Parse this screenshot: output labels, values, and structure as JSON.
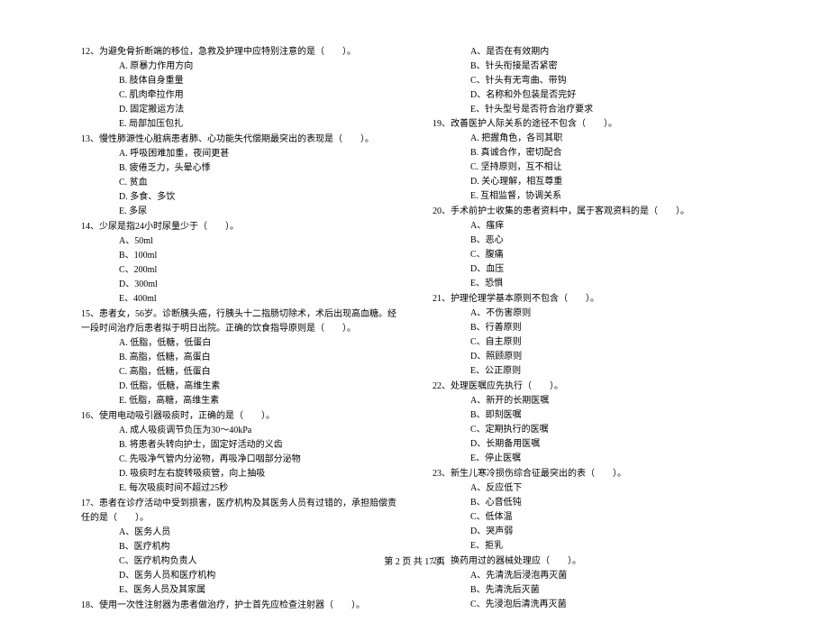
{
  "footer": "第 2 页 共 17 页",
  "left": [
    {
      "stem": "12、为避免骨折断端的移位，急救及护理中应特别注意的是（　　）。",
      "opts": [
        "A. 原暴力作用方向",
        "B. 肢体自身重量",
        "C. 肌肉牵拉作用",
        "D. 固定搬运方法",
        "E. 局部加压包扎"
      ]
    },
    {
      "stem": "13、慢性肺源性心脏病患者肺、心功能失代偿期最突出的表现是（　　）。",
      "opts": [
        "A. 呼吸困难加重，夜间更甚",
        "B. 疲倦乏力，头晕心悸",
        "C. 贫血",
        "D. 多食、多饮",
        "E. 多尿"
      ]
    },
    {
      "stem": "14、少尿是指24小时尿量少于（　　）。",
      "opts": [
        "A、50ml",
        "B、100ml",
        "C、200ml",
        "D、300ml",
        "E、400ml"
      ]
    },
    {
      "stem": "15、患者女，56岁。诊断胰头癌，行胰头十二指肠切除术，术后出现高血糖。经一段时间治疗后患者拟于明日出院。正确的饮食指导原则是（　　）。",
      "opts": [
        "A. 低脂，低糖，低蛋白",
        "B. 高脂，低糖，高蛋白",
        "C. 高脂，低糖，低蛋白",
        "D. 低脂，低糖，高维生素",
        "E. 低脂，高糖，高维生素"
      ]
    },
    {
      "stem": "16、使用电动吸引器吸痰时，正确的是（　　）。",
      "opts": [
        "A. 成人吸痰调节负压为30～40kPa",
        "B. 将患者头转向护士，固定好活动的义齿",
        "C. 先吸净气管内分泌物，再吸净口咽部分泌物",
        "D. 吸痰时左右旋转吸痰管，向上抽吸",
        "E. 每次吸痰时间不超过25秒"
      ]
    },
    {
      "stem": "17、患者在诊疗活动中受到损害，医疗机构及其医务人员有过错的，承担赔偿责任的是（　　）。",
      "opts": [
        "A、医务人员",
        "B、医疗机构",
        "C、医疗机构负责人",
        "D、医务人员和医疗机构",
        "E、医务人员及其家属"
      ]
    },
    {
      "stem": "18、使用一次性注射器为患者做治疗，护士首先应检查注射器（　　）。",
      "opts": []
    }
  ],
  "right_pre": [
    "A、是否在有效期内",
    "B、针头衔接是否紧密",
    "C、针头有无弯曲、带钩",
    "D、名称和外包装是否完好",
    "E、针头型号是否符合治疗要求"
  ],
  "right": [
    {
      "stem": "19、改善医护人际关系的途径不包含（　　）。",
      "opts": [
        "A. 把握角色，各司其职",
        "B. 真诚合作，密切配合",
        "C. 坚持原则，互不相让",
        "D. 关心理解，相互尊重",
        "E. 互相监督，协调关系"
      ]
    },
    {
      "stem": "20、手术前护士收集的患者资料中，属于客观资料的是（　　）。",
      "opts": [
        "A、瘙痒",
        "B、恶心",
        "C、腹痛",
        "D、血压",
        "E、恐惧"
      ]
    },
    {
      "stem": "21、护理伦理学基本原则不包含（　　）。",
      "opts": [
        "A、不伤害原则",
        "B、行善原则",
        "C、自主原则",
        "D、照顾原则",
        "E、公正原则"
      ]
    },
    {
      "stem": "22、处理医嘱应先执行（　　）。",
      "opts": [
        "A、新开的长期医嘱",
        "B、即刻医嘱",
        "C、定期执行的医嘱",
        "D、长期备用医嘱",
        "E、停止医嘱"
      ]
    },
    {
      "stem": "23、新生儿寒冷损伤综合征最突出的表（　　）。",
      "opts": [
        "A、反应低下",
        "B、心音低钝",
        "C、低体温",
        "D、哭声弱",
        "E、拒乳"
      ]
    },
    {
      "stem": "24、换药用过的器械处理应（　　）。",
      "opts": [
        "A、先清洗后浸泡再灭菌",
        "B、先清洗后灭菌",
        "C、先浸泡后清洗再灭菌"
      ]
    }
  ]
}
